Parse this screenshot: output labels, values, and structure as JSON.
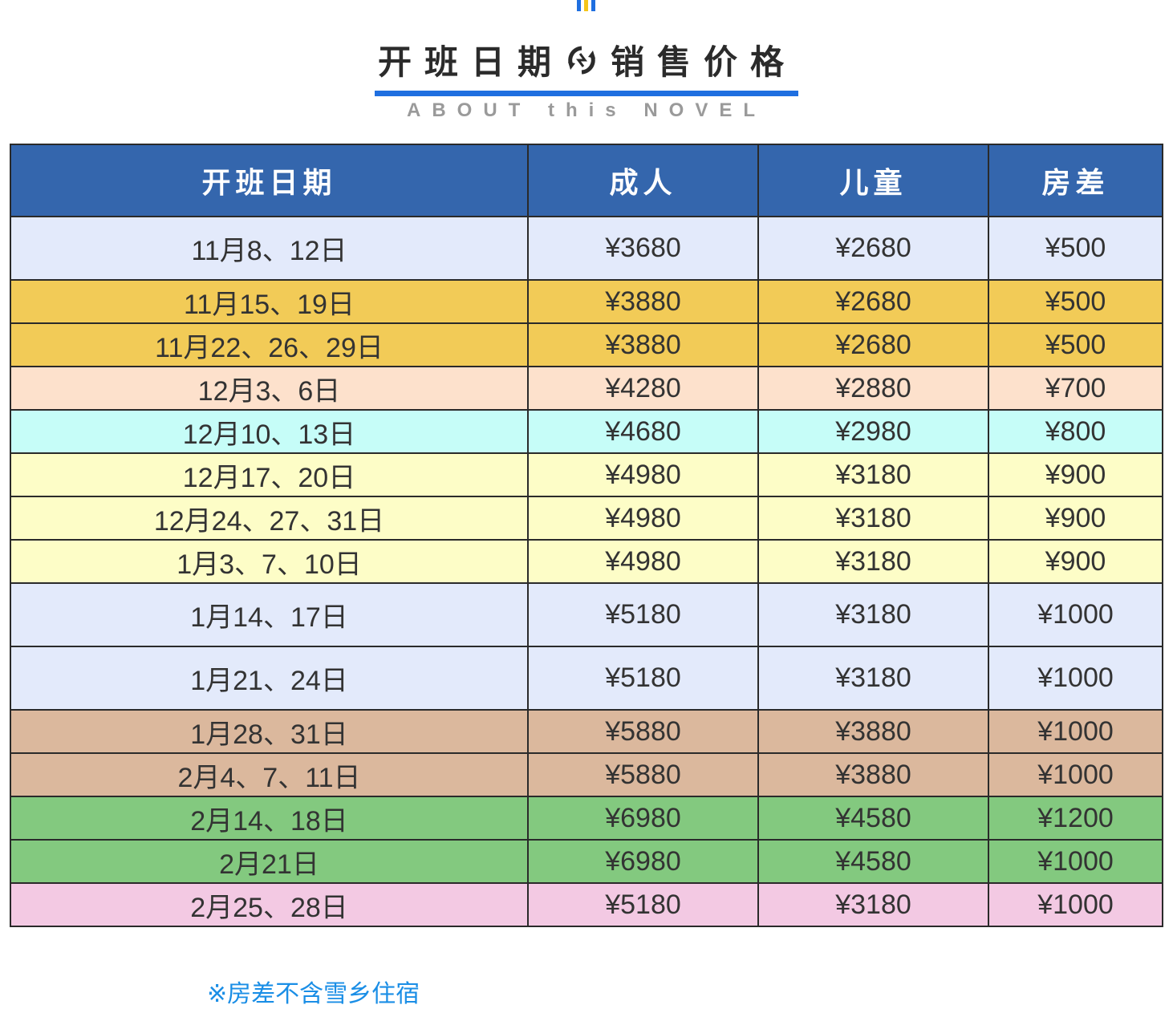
{
  "header": {
    "title_left": "开班日期",
    "title_right": "销售价格",
    "subtitle": "ABOUT this NOVEL",
    "accent_color": "#1f6fe0"
  },
  "table": {
    "columns": [
      "开班日期",
      "成人",
      "儿童",
      "房差"
    ],
    "header_bg": "#3466ad",
    "rows": [
      {
        "date": "11月8、12日",
        "adult": "¥3680",
        "child": "¥2680",
        "room": "¥500",
        "bg": "#e3eafb",
        "red": true,
        "tall": true
      },
      {
        "date": "11月15、19日",
        "adult": "¥3880",
        "child": "¥2680",
        "room": "¥500",
        "bg": "#f2cb57",
        "red": false,
        "tall": false
      },
      {
        "date": "11月22、26、29日",
        "adult": "¥3880",
        "child": "¥2680",
        "room": "¥500",
        "bg": "#f2cb57",
        "red": false,
        "tall": false
      },
      {
        "date": "12月3、6日",
        "adult": "¥4280",
        "child": "¥2880",
        "room": "¥700",
        "bg": "#fde1cc",
        "red": false,
        "tall": false
      },
      {
        "date": "12月10、13日",
        "adult": "¥4680",
        "child": "¥2980",
        "room": "¥800",
        "bg": "#c6fdf8",
        "red": false,
        "tall": false
      },
      {
        "date": "12月17、20日",
        "adult": "¥4980",
        "child": "¥3180",
        "room": "¥900",
        "bg": "#fdfdc7",
        "red": false,
        "tall": false
      },
      {
        "date": "12月24、27、31日",
        "adult": "¥4980",
        "child": "¥3180",
        "room": "¥900",
        "bg": "#fdfdc7",
        "red": false,
        "tall": false
      },
      {
        "date": "1月3、7、10日",
        "adult": "¥4980",
        "child": "¥3180",
        "room": "¥900",
        "bg": "#fdfdc7",
        "red": false,
        "tall": false
      },
      {
        "date": "1月14、17日",
        "adult": "¥5180",
        "child": "¥3180",
        "room": "¥1000",
        "bg": "#e3eafb",
        "red": true,
        "tall": true
      },
      {
        "date": "1月21、24日",
        "adult": "¥5180",
        "child": "¥3180",
        "room": "¥1000",
        "bg": "#e3eafb",
        "red": true,
        "tall": true
      },
      {
        "date": "1月28、31日",
        "adult": "¥5880",
        "child": "¥3880",
        "room": "¥1000",
        "bg": "#dbb89d",
        "red": false,
        "tall": false
      },
      {
        "date": "2月4、7、11日",
        "adult": "¥5880",
        "child": "¥3880",
        "room": "¥1000",
        "bg": "#dbb89d",
        "red": false,
        "tall": false
      },
      {
        "date": "2月14、18日",
        "adult": "¥6980",
        "child": "¥4580",
        "room": "¥1200",
        "bg": "#83c97f",
        "red": false,
        "tall": false
      },
      {
        "date": "2月21日",
        "adult": "¥6980",
        "child": "¥4580",
        "room": "¥1000",
        "bg": "#83c97f",
        "red": false,
        "tall": false
      },
      {
        "date": "2月25、28日",
        "adult": "¥5180",
        "child": "¥3180",
        "room": "¥1000",
        "bg": "#f3c9e3",
        "red": false,
        "tall": false
      }
    ]
  },
  "note": "※房差不含雪乡住宿"
}
